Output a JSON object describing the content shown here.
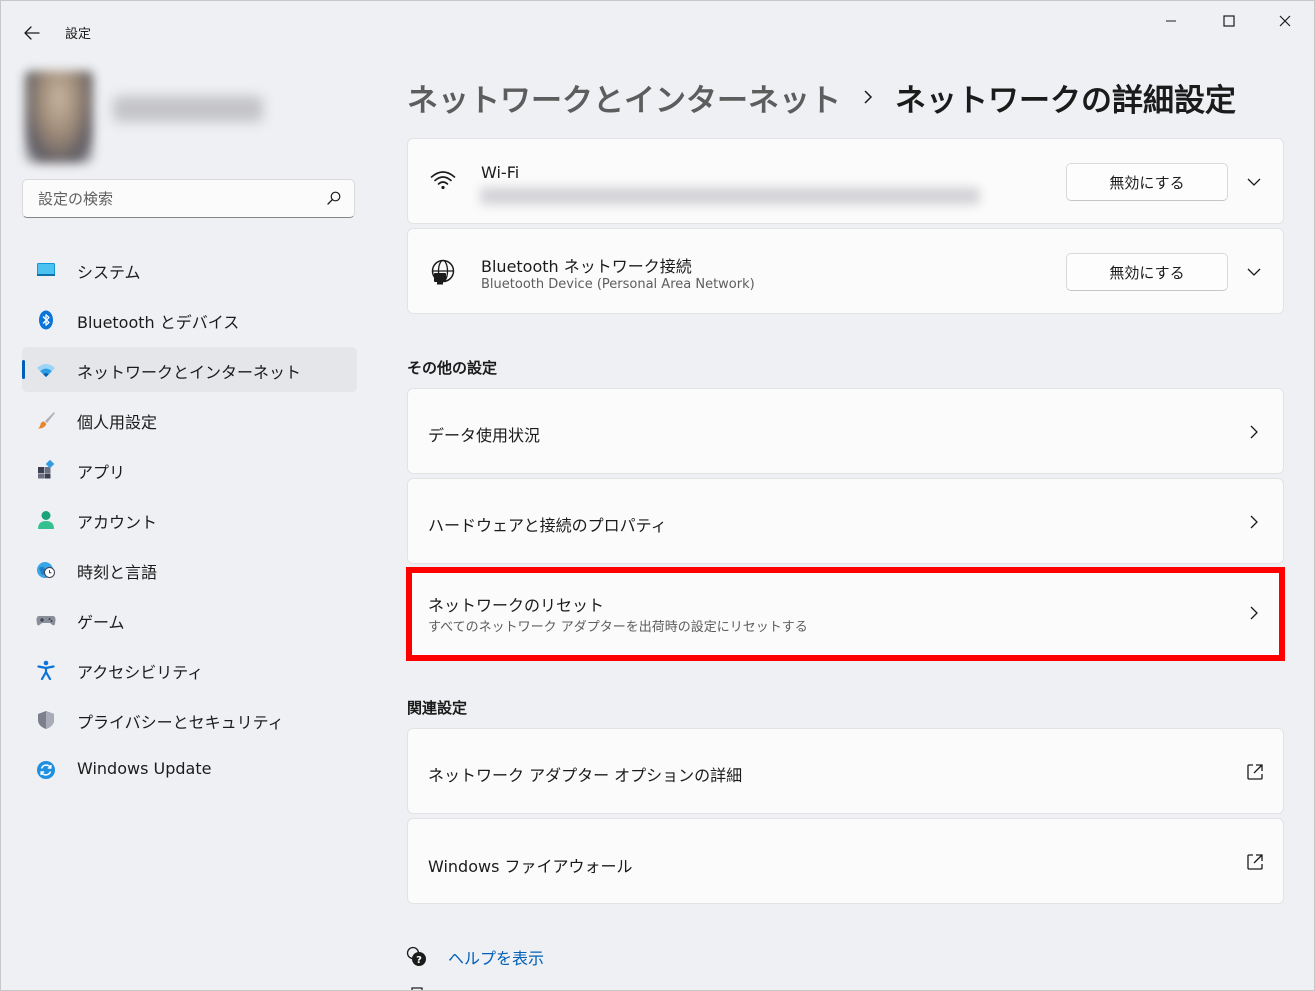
{
  "window": {
    "title": "設定",
    "back_icon": "arrow-left-icon",
    "controls": [
      "minimize-icon",
      "maximize-icon",
      "close-icon"
    ]
  },
  "sidebar": {
    "search": {
      "placeholder": "設定の検索",
      "value": ""
    },
    "items": [
      {
        "label": "システム",
        "icon": "system-monitor-icon",
        "active": false
      },
      {
        "label": "Bluetooth とデバイス",
        "icon": "bluetooth-icon",
        "active": false
      },
      {
        "label": "ネットワークとインターネット",
        "icon": "wifi-network-icon",
        "active": true
      },
      {
        "label": "個人用設定",
        "icon": "paintbrush-icon",
        "active": false
      },
      {
        "label": "アプリ",
        "icon": "apps-grid-icon",
        "active": false
      },
      {
        "label": "アカウント",
        "icon": "account-person-icon",
        "active": false
      },
      {
        "label": "時刻と言語",
        "icon": "globe-clock-icon",
        "active": false
      },
      {
        "label": "ゲーム",
        "icon": "game-controller-icon",
        "active": false
      },
      {
        "label": "アクセシビリティ",
        "icon": "accessibility-icon",
        "active": false
      },
      {
        "label": "プライバシーとセキュリティ",
        "icon": "shield-icon",
        "active": false
      },
      {
        "label": "Windows Update",
        "icon": "windows-update-icon",
        "active": false
      }
    ]
  },
  "breadcrumb": {
    "parent": "ネットワークとインターネット",
    "current": "ネットワークの詳細設定"
  },
  "adapters": [
    {
      "title": "Wi-Fi",
      "subtitle": "",
      "button": "無効にする",
      "icon": "wifi-icon"
    },
    {
      "title": "Bluetooth ネットワーク接続",
      "subtitle": "Bluetooth Device (Personal Area Network)",
      "button": "無効にする",
      "icon": "ethernet-globe-icon"
    }
  ],
  "other_settings": {
    "title": "その他の設定",
    "items": [
      {
        "title": "データ使用状況",
        "subtitle": ""
      },
      {
        "title": "ハードウェアと接続のプロパティ",
        "subtitle": ""
      },
      {
        "title": "ネットワークのリセット",
        "subtitle": "すべてのネットワーク アダプターを出荷時の設定にリセットする",
        "highlighted": true
      }
    ]
  },
  "related_settings": {
    "title": "関連設定",
    "items": [
      {
        "title": "ネットワーク アダプター オプションの詳細",
        "icon": "external-link-icon"
      },
      {
        "title": "Windows ファイアウォール",
        "icon": "external-link-icon"
      }
    ]
  },
  "help": {
    "label": "ヘルプを表示",
    "icon": "help-icon"
  },
  "colors": {
    "accent": "#005fb8",
    "highlight_border": "#ff0000",
    "background": "#eef0f3",
    "card": "#fbfbfb"
  }
}
